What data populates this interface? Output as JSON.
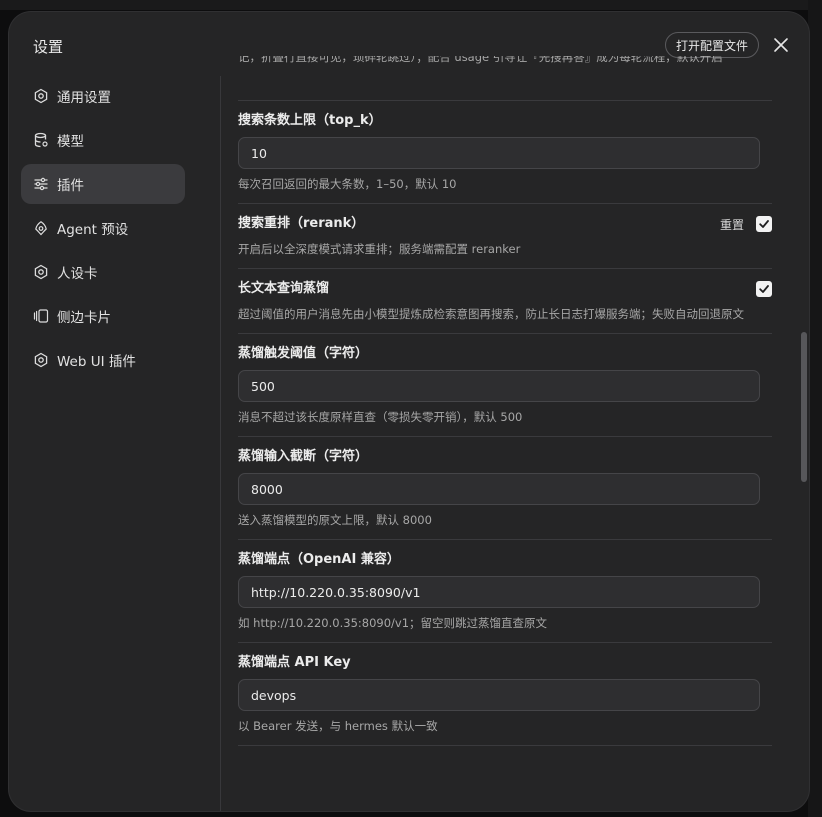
{
  "window": {
    "title": "设置",
    "open_config_label": "打开配置文件"
  },
  "sidebar": {
    "items": [
      {
        "label": "通用设置",
        "icon": "gear-icon"
      },
      {
        "label": "模型",
        "icon": "database-icon"
      },
      {
        "label": "插件",
        "icon": "sliders-icon",
        "active": true
      },
      {
        "label": "Agent 预设",
        "icon": "agent-icon"
      },
      {
        "label": "人设卡",
        "icon": "gear-icon"
      },
      {
        "label": "侧边卡片",
        "icon": "cards-icon"
      },
      {
        "label": "Web UI 插件",
        "icon": "gear-icon"
      }
    ]
  },
  "settings": {
    "partial_desc": "记，折叠行直接可见，琐碎轮跳过）；配合 usage 引导让『先搜再答』成为每轮流程，默认开启",
    "top_k": {
      "label": "搜索条数上限（top_k）",
      "value": "10",
      "desc": "每次召回返回的最大条数，1–50，默认 10"
    },
    "rerank": {
      "label": "搜索重排（rerank）",
      "reset_label": "重置",
      "checked": true,
      "desc": "开启后以全深度模式请求重排；服务端需配置 reranker"
    },
    "distill": {
      "label": "长文本查询蒸馏",
      "checked": true,
      "desc": "超过阈值的用户消息先由小模型提炼成检索意图再搜索，防止长日志打爆服务端；失败自动回退原文"
    },
    "distill_threshold": {
      "label": "蒸馏触发阈值（字符）",
      "value": "500",
      "desc": "消息不超过该长度原样直查（零损失零开销），默认 500"
    },
    "distill_truncate": {
      "label": "蒸馏输入截断（字符）",
      "value": "8000",
      "desc": "送入蒸馏模型的原文上限，默认 8000"
    },
    "distill_endpoint": {
      "label": "蒸馏端点（OpenAI 兼容）",
      "value": "http://10.220.0.35:8090/v1",
      "desc": "如 http://10.220.0.35:8090/v1；留空则跳过蒸馏直查原文"
    },
    "distill_api_key": {
      "label": "蒸馏端点 API Key",
      "value": "devops",
      "desc": "以 Bearer 发送，与 hermes 默认一致"
    }
  },
  "colors": {
    "modal_bg": "#252526",
    "active_nav_bg": "#3b3b3e",
    "input_bg": "#2e2e30",
    "muted_text": "#a7a7a7"
  }
}
